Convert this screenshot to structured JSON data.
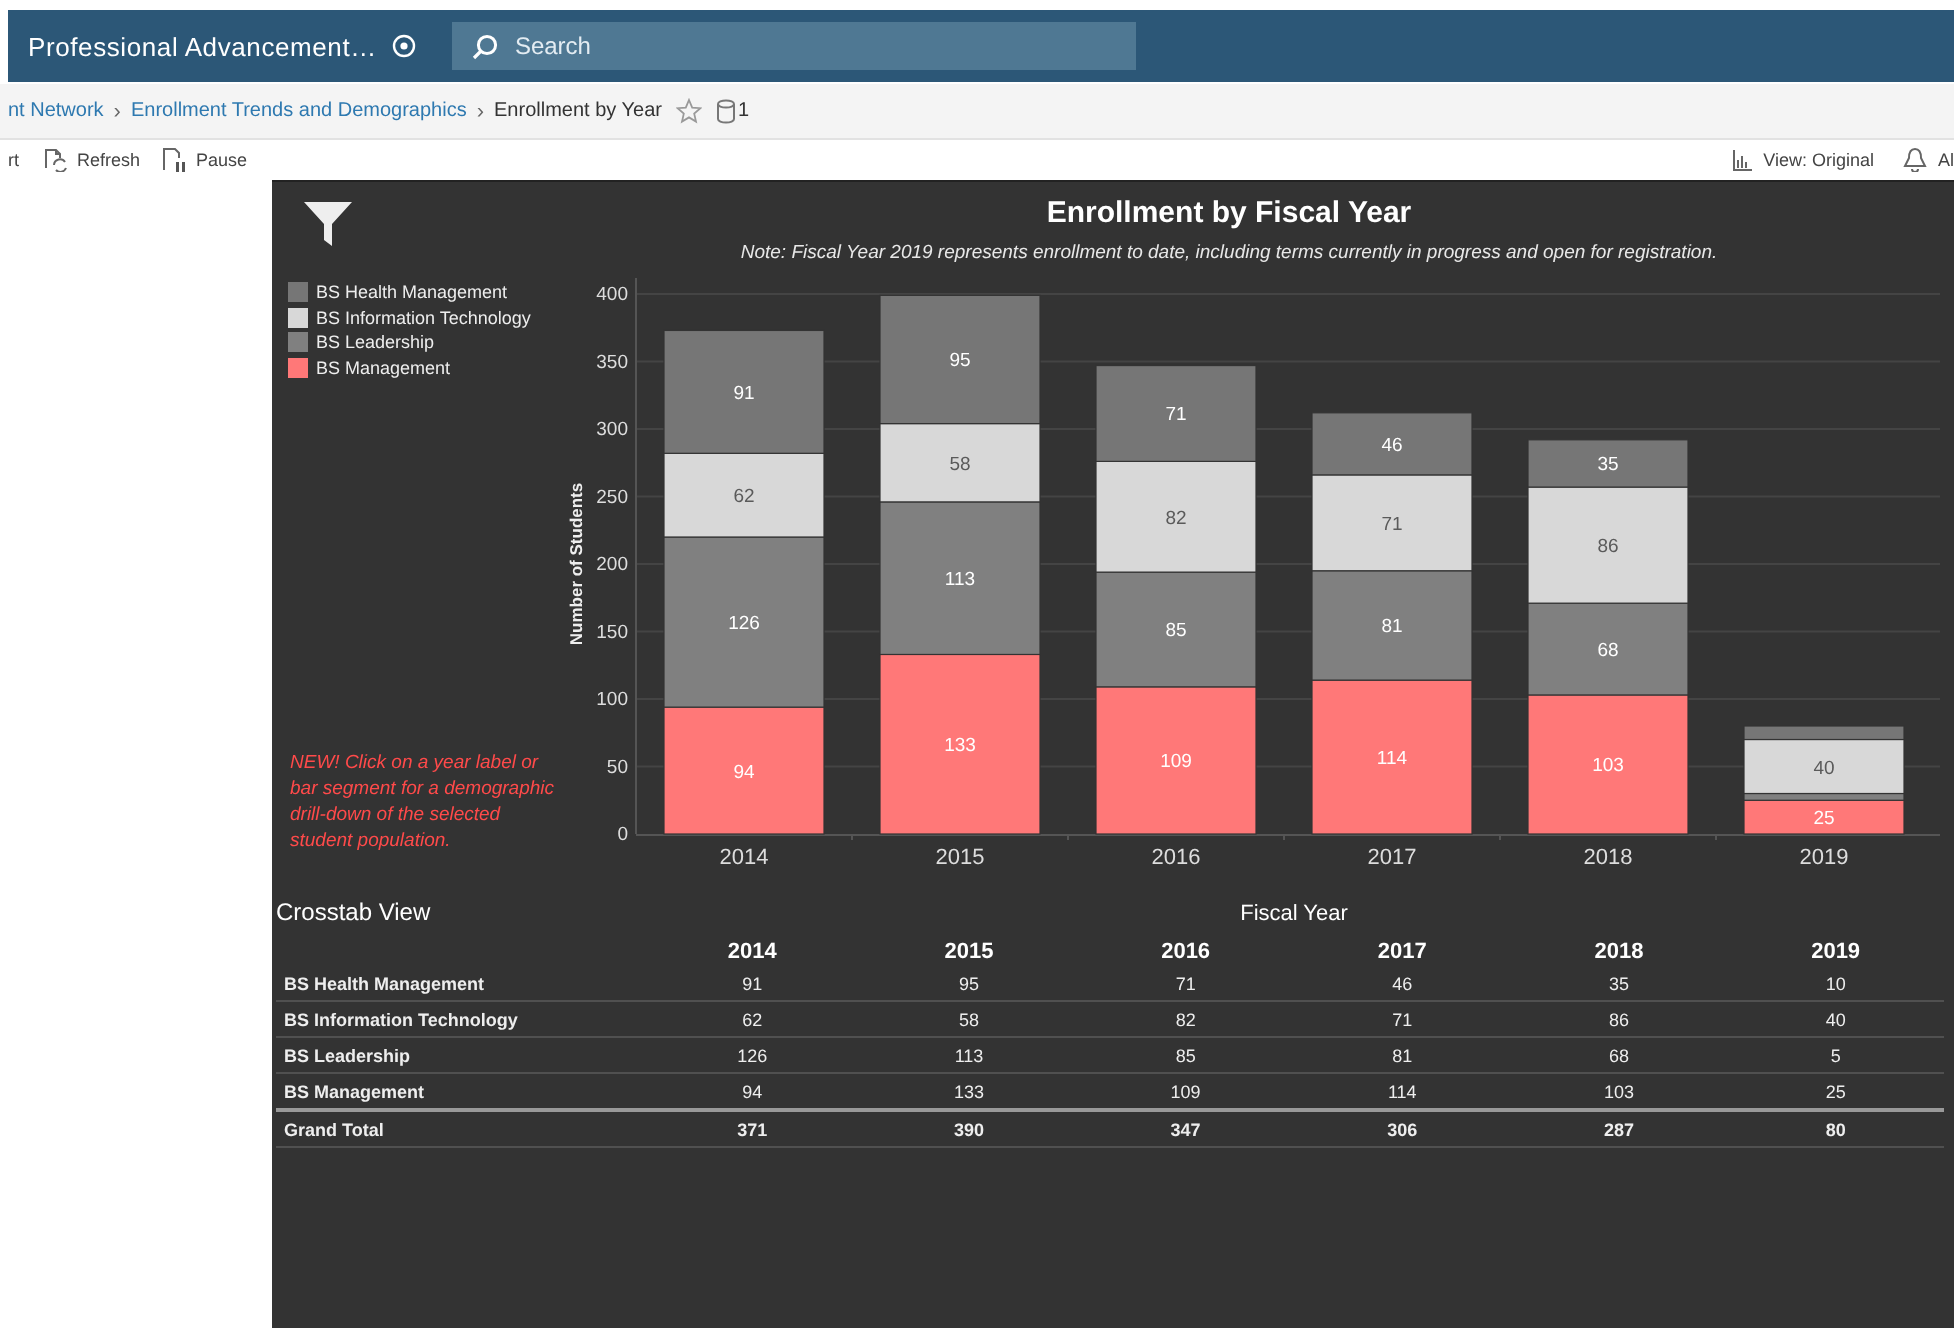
{
  "header": {
    "title": "Professional Advancement…",
    "search": {
      "placeholder": "Search"
    }
  },
  "breadcrumb": {
    "items": [
      {
        "label": "nt Network",
        "kind": "link"
      },
      {
        "label": "Enrollment Trends and Demographics",
        "kind": "link"
      },
      {
        "label": "Enrollment by Year",
        "kind": "current"
      }
    ],
    "separators": [
      "›",
      "›"
    ],
    "data_source_count": "1"
  },
  "toolbar": {
    "left": [
      {
        "label": "rt",
        "kind": "plain"
      },
      {
        "label": "Refresh",
        "kind": "refresh"
      },
      {
        "label": "Pause",
        "kind": "pause"
      }
    ],
    "right": [
      {
        "label": "View: Original",
        "kind": "view"
      },
      {
        "label": "Al",
        "kind": "alert"
      }
    ]
  },
  "drilldown_note": "NEW! Click on a year label or bar segment for a demographic drill-down of the selected student population.",
  "chart": {
    "note": "Note: Fiscal Year 2019 represents enrollment to date, including terms currently in progress and open for registration.",
    "chart_data": {
      "type": "bar",
      "title": "Enrollment by Fiscal Year",
      "ylabel": "Number of Students",
      "categories": [
        "2014",
        "2015",
        "2016",
        "2017",
        "2018",
        "2019"
      ],
      "stacked": true,
      "grid": true,
      "ylim": [
        0,
        400
      ],
      "yticks": [
        0,
        50,
        100,
        150,
        200,
        250,
        300,
        350,
        400
      ],
      "series": [
        {
          "name": "BS Health Management",
          "color": "#767676",
          "values": [
            91,
            95,
            71,
            46,
            35,
            10
          ],
          "value_labels": [
            "91",
            "95",
            "71",
            "46",
            "35",
            null
          ]
        },
        {
          "name": "BS Information Technology",
          "color": "#d8d8d8",
          "values": [
            62,
            58,
            82,
            71,
            86,
            40
          ],
          "value_labels": [
            "62",
            "58",
            "82",
            "71",
            "86",
            "40"
          ]
        },
        {
          "name": "BS Leadership",
          "color": "#808080",
          "values": [
            126,
            113,
            85,
            81,
            68,
            5
          ],
          "value_labels": [
            "126",
            "113",
            "85",
            "81",
            "68",
            null
          ]
        },
        {
          "name": "BS Management",
          "color": "#ff7878",
          "values": [
            94,
            133,
            109,
            114,
            103,
            25
          ],
          "value_labels": [
            "94",
            "133",
            "109",
            "114",
            "103",
            "25"
          ]
        }
      ]
    }
  },
  "crosstab": {
    "title": "Crosstab View",
    "column_group": "Fiscal Year",
    "columns": [
      "2014",
      "2015",
      "2016",
      "2017",
      "2018",
      "2019"
    ],
    "rows": [
      {
        "label": "BS Health Management",
        "values": [
          "91",
          "95",
          "71",
          "46",
          "35",
          "10"
        ]
      },
      {
        "label": "BS Information Technology",
        "values": [
          "62",
          "58",
          "82",
          "71",
          "86",
          "40"
        ]
      },
      {
        "label": "BS Leadership",
        "values": [
          "126",
          "113",
          "85",
          "81",
          "68",
          "5"
        ]
      },
      {
        "label": "BS Management",
        "values": [
          "94",
          "133",
          "109",
          "114",
          "103",
          "25"
        ]
      }
    ],
    "total": {
      "label": "Grand Total",
      "values": [
        "371",
        "390",
        "347",
        "306",
        "287",
        "80"
      ]
    }
  }
}
